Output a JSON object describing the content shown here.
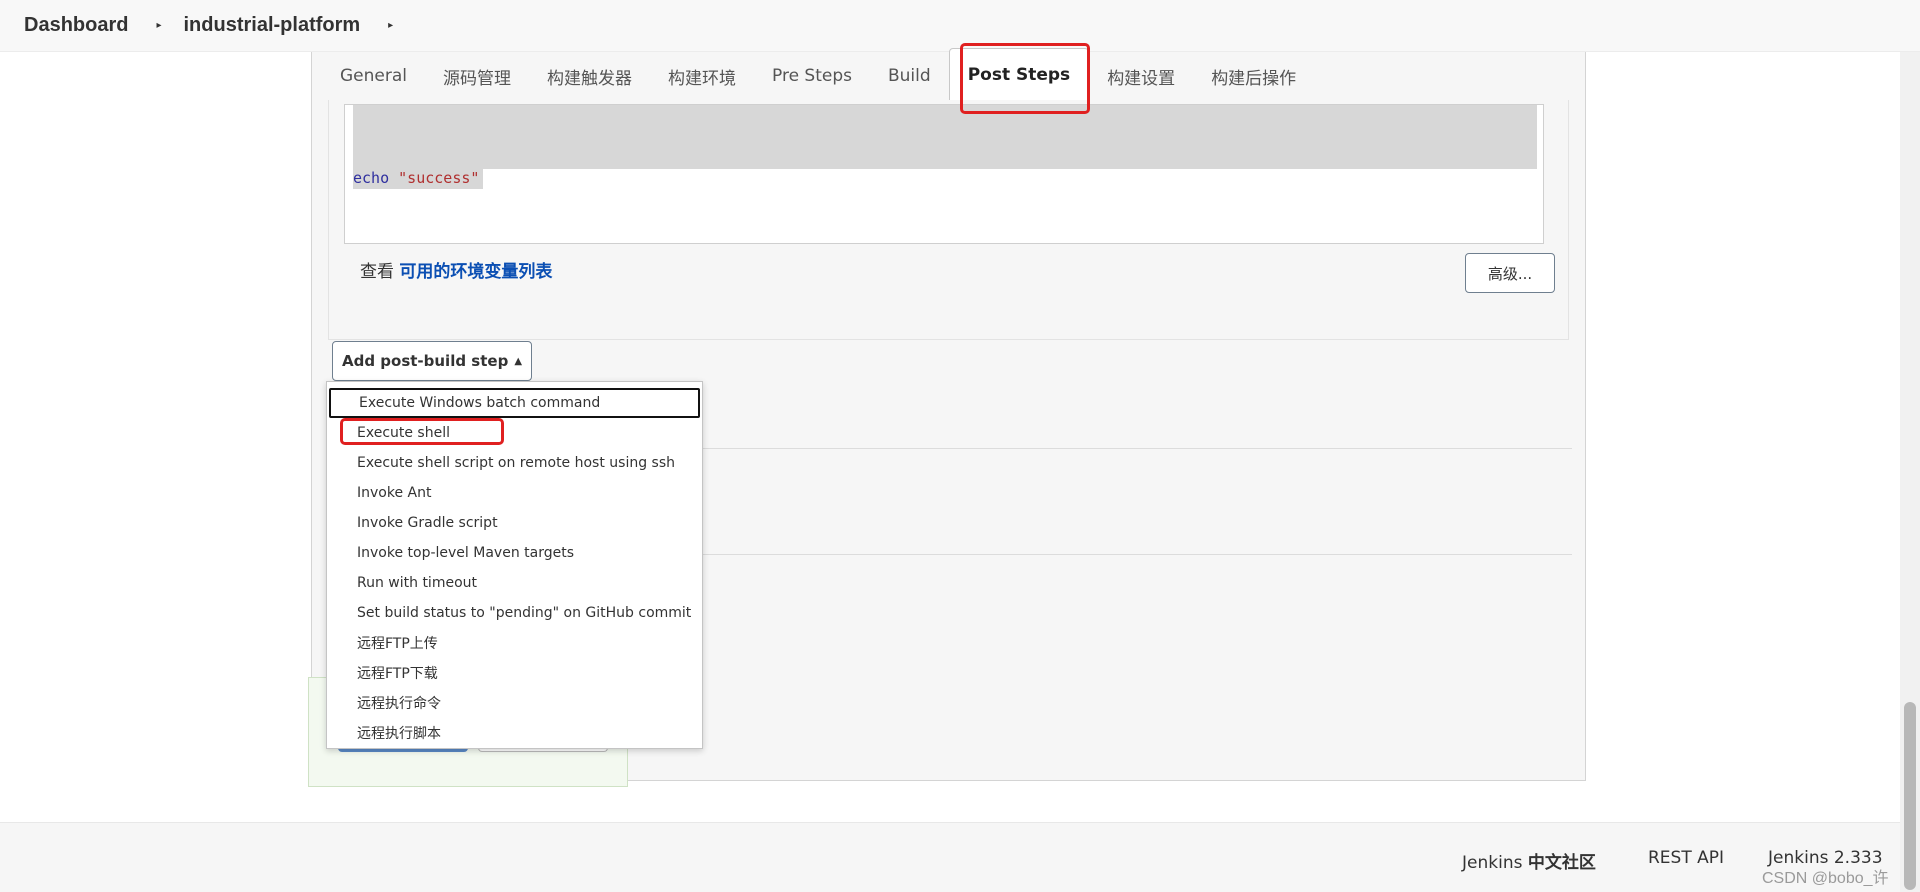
{
  "breadcrumb": {
    "items": [
      "Dashboard",
      "industrial-platform"
    ],
    "separator": "▸"
  },
  "tabs": [
    {
      "label": "General",
      "active": false
    },
    {
      "label": "源码管理",
      "active": false
    },
    {
      "label": "构建触发器",
      "active": false
    },
    {
      "label": "构建环境",
      "active": false
    },
    {
      "label": "Pre Steps",
      "active": false
    },
    {
      "label": "Build",
      "active": false
    },
    {
      "label": "Post Steps",
      "active": true
    },
    {
      "label": "构建设置",
      "active": false
    },
    {
      "label": "构建后操作",
      "active": false
    }
  ],
  "code": {
    "keyword": "echo",
    "string": "\"success\""
  },
  "env": {
    "prefix": "查看",
    "link": "可用的环境变量列表"
  },
  "advanced_button": "高级...",
  "add_step_button": "Add post-build step",
  "menu": {
    "items": [
      "Execute Windows batch command",
      "Execute shell",
      "Execute shell script on remote host using ssh",
      "Invoke Ant",
      "Invoke Gradle script",
      "Invoke top-level Maven targets",
      "Run with timeout",
      "Set build status to \"pending\" on GitHub commit",
      "远程FTP上传",
      "远程FTP下载",
      "远程执行命令",
      "远程执行脚本"
    ],
    "focused_index": 0,
    "highlighted_index": 1
  },
  "footer": {
    "community_prefix": "Jenkins",
    "community_strong": "中文社区",
    "rest_api": "REST API",
    "version": "Jenkins 2.333"
  },
  "watermark": "CSDN @bobo_许",
  "colors": {
    "link": "#0b4fb3",
    "annotation": "#e02020",
    "code_keyword": "#2f2f9f",
    "code_string": "#b03030"
  }
}
